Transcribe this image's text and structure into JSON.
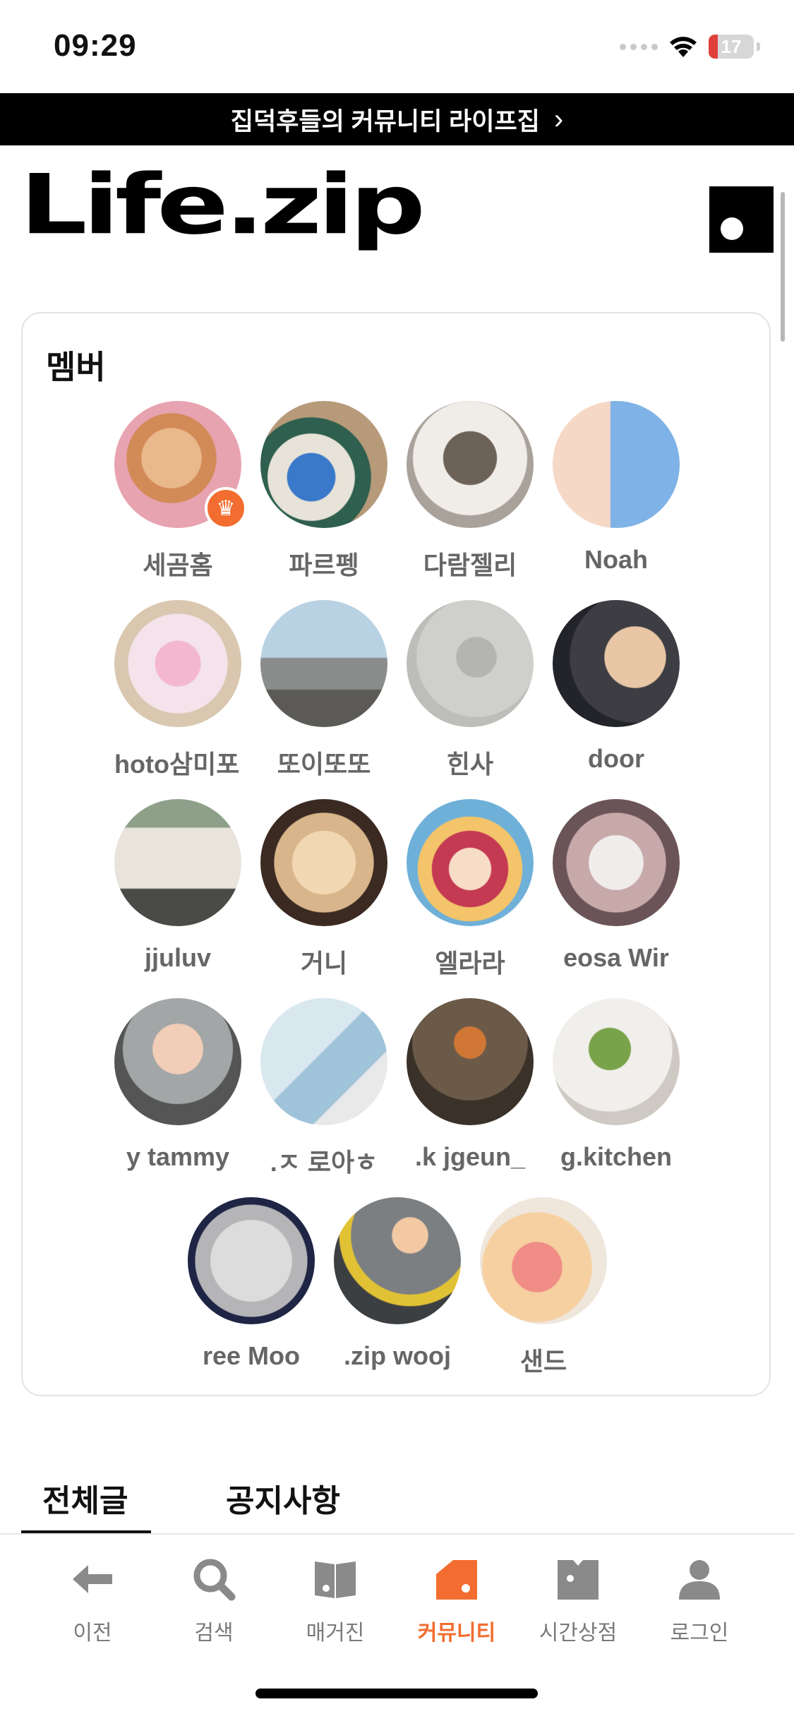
{
  "status_bar": {
    "time": "09:29",
    "battery": "17"
  },
  "banner": {
    "text": "집덕후들의 커뮤니티 라이프집",
    "chevron": "›"
  },
  "header": {
    "logo_text": "Life.zip"
  },
  "members": {
    "title": "멤버",
    "rows": [
      [
        "세곰홈",
        "파르펭",
        "다람젤리",
        "Noah"
      ],
      [
        "hoto삼미포!",
        "또이또또",
        "힌사",
        "door"
      ],
      [
        "jjuluv",
        "거니",
        "엘라라",
        "eosa  Wir"
      ],
      [
        "y  tammy",
        ".ㅈ 로아ㅎ",
        ".k jgeun_",
        "g.kitchen"
      ],
      [
        "ree  Moo",
        ".zip  wooj",
        "샌드"
      ]
    ]
  },
  "tabs": {
    "all": "전체글",
    "notice": "공지사항"
  },
  "bottom_nav": {
    "back": "이전",
    "search": "검색",
    "magazine": "매거진",
    "community": "커뮤니티",
    "timesale": "시간상점",
    "login": "로그인"
  },
  "colors": {
    "accent": "#f26d2f",
    "banner_bg": "#000000"
  }
}
